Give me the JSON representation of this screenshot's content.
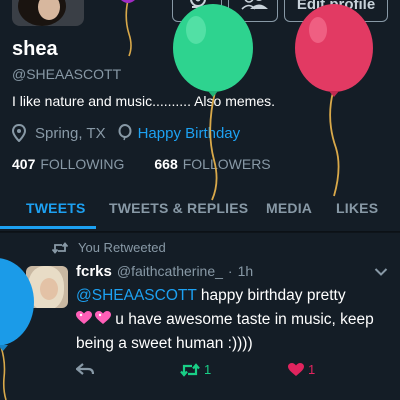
{
  "profile": {
    "name": "shea",
    "handle": "@SHEAASCOTT",
    "bio": "I like nature and music.......... Also memes.",
    "location": "Spring, TX",
    "birthday": "Happy Birthday",
    "following_count": "407",
    "following_label": "FOLLOWING",
    "followers_count": "668",
    "followers_label": "FOLLOWERS",
    "edit_label": "Edit profile"
  },
  "tabs": [
    {
      "label": "TWEETS",
      "active": true
    },
    {
      "label": "TWEETS & REPLIES",
      "active": false
    },
    {
      "label": "MEDIA",
      "active": false
    },
    {
      "label": "LIKES",
      "active": false
    }
  ],
  "tweet": {
    "retweet_note": "You Retweeted",
    "author_name": "fcrks",
    "author_handle": "@faithcatherine_",
    "separator": "·",
    "time": "1h",
    "mention": "@SHEAASCOTT",
    "text_part1": " happy birthday pretty",
    "text_part2": " u have awesome taste in music, keep being a sweet human :))))",
    "retweet_count": "1",
    "like_count": "1"
  },
  "colors": {
    "background": "#141d26",
    "accent": "#1da1f2",
    "muted": "#8899a6",
    "retweet": "#19cf86",
    "like": "#e0245e"
  },
  "icons": [
    "gear-icon",
    "people-icon",
    "location-pin-icon",
    "balloon-icon",
    "chevron-down-icon",
    "reply-icon",
    "retweet-icon",
    "heart-icon"
  ]
}
